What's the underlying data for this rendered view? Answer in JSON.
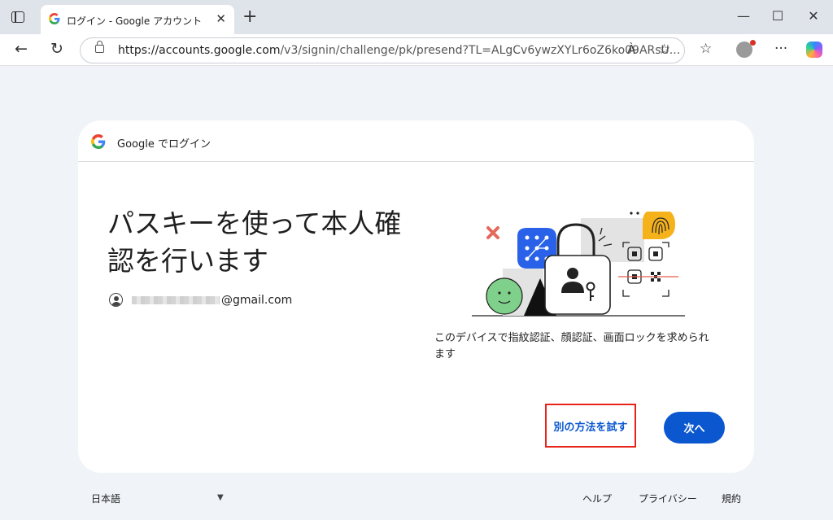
{
  "browser": {
    "tab_title": "ログイン - Google アカウント",
    "url_host": "https://accounts.google.com",
    "url_path": "/v3/signin/challenge/pk/presend?TL=ALgCv6ywzXYLr6oZ6ko09ARsU...",
    "read_aloud_glyph": "À"
  },
  "card": {
    "header_label": "Google でログイン",
    "heading": "パスキーを使って本人確認を行います",
    "account_email": "@gmail.com",
    "description": "このデバイスで指紋認証、顔認証、画面ロックを求められます",
    "try_another_label": "別の方法を試す",
    "next_label": "次へ"
  },
  "footer": {
    "language": "日本語",
    "help": "ヘルプ",
    "privacy": "プライバシー",
    "terms": "規約"
  },
  "colors": {
    "primary_blue": "#0b57d0",
    "highlight_red": "#e8231a",
    "page_bg": "#f0f3f8"
  }
}
